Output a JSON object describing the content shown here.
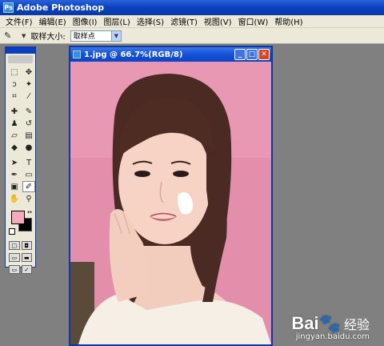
{
  "window": {
    "title": "Adobe Photoshop",
    "logo_text": "Ps"
  },
  "menu": [
    {
      "label": "文件(F)"
    },
    {
      "label": "编辑(E)"
    },
    {
      "label": "图像(I)"
    },
    {
      "label": "图层(L)"
    },
    {
      "label": "选择(S)"
    },
    {
      "label": "滤镜(T)"
    },
    {
      "label": "视图(V)"
    },
    {
      "label": "窗口(W)"
    },
    {
      "label": "帮助(H)"
    }
  ],
  "options": {
    "sample_size_label": "取样大小:",
    "sample_size_value": "取样点"
  },
  "document": {
    "title": "1.jpg @ 66.7%(RGB/8)"
  },
  "colors": {
    "foreground": "#f5a9bd",
    "background": "#000000",
    "accent": "#0a3aa8"
  },
  "watermark": {
    "logo": "Bai",
    "paw": "🐾",
    "brand_cn": "经验",
    "url": "jingyan.baidu.com"
  }
}
